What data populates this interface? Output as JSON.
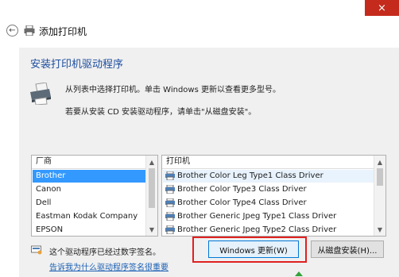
{
  "window": {
    "close_label": "×"
  },
  "header": {
    "back_glyph": "←",
    "title": "添加打印机"
  },
  "section": {
    "title": "安装打印机驱动程序",
    "description_line1": "从列表中选择打印机。单击 Windows 更新以查看更多型号。",
    "description_line2": "若要从安装 CD 安装驱动程序，请单击\"从磁盘安装\"。"
  },
  "manufacturers": {
    "header": "厂商",
    "items": [
      "Brother",
      "Canon",
      "Dell",
      "Eastman Kodak Company",
      "EPSON"
    ],
    "selected": "Brother"
  },
  "printers": {
    "header": "打印机",
    "items": [
      "Brother Color Leg Type1 Class Driver",
      "Brother Color Type3 Class Driver",
      "Brother Color Type4 Class Driver",
      "Brother Generic Jpeg Type1 Class Driver",
      "Brother Generic Jpeg Type2 Class Driver"
    ],
    "highlighted": "Brother Color Leg Type1 Class Driver"
  },
  "signature": {
    "text": "这个驱动程序已经过数字签名。",
    "link": "告诉我为什么驱动程序签名很重要"
  },
  "buttons": {
    "windows_update": "Windows 更新(W)",
    "have_disk": "从磁盘安装(H)..."
  },
  "colors": {
    "accent_title": "#1c4d9e",
    "selection": "#3399ff",
    "close_button": "#c42b1c",
    "highlight_frame": "#e02020",
    "link": "#1a5fb4"
  }
}
